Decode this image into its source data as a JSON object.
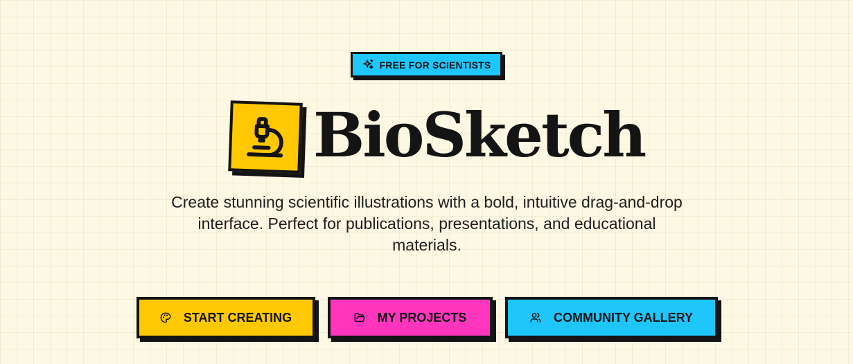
{
  "badge": {
    "label": "FREE FOR SCIENTISTS",
    "icon": "sparkles-icon"
  },
  "brand": {
    "name": "BioSketch",
    "logo_icon": "microscope-icon"
  },
  "description": "Create stunning scientific illustrations with a bold, intuitive drag-and-drop interface. Perfect for publications, presentations, and educational materials.",
  "actions": [
    {
      "label": "START CREATING",
      "icon": "palette-icon",
      "color": "#ffc800"
    },
    {
      "label": "MY PROJECTS",
      "icon": "folder-icon",
      "color": "#ff35bd"
    },
    {
      "label": "COMMUNITY GALLERY",
      "icon": "users-icon",
      "color": "#1ec6fb"
    }
  ],
  "colors": {
    "background": "#fdf8e4",
    "ink": "#141414",
    "yellow": "#ffc800",
    "pink": "#ff35bd",
    "cyan": "#1ec6fb"
  }
}
